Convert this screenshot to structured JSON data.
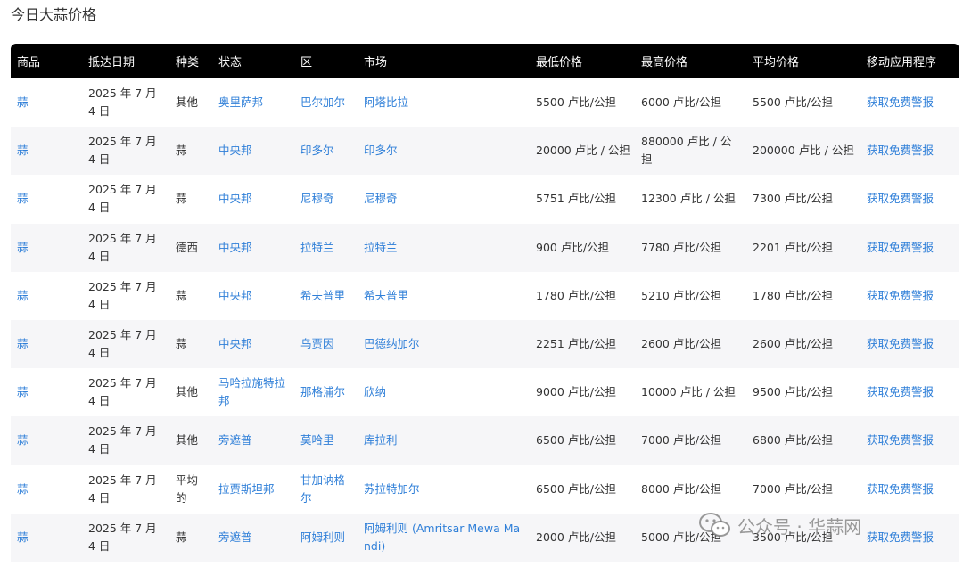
{
  "page_title": "今日大蒜价格",
  "columns": [
    "商品",
    "抵达日期",
    "种类",
    "状态",
    "区",
    "市场",
    "最低价格",
    "最高价格",
    "平均价格",
    "移动应用程序"
  ],
  "rows": [
    {
      "commodity": "蒜",
      "date": "2025 年 7 月 4 日",
      "variety": "其他",
      "state": "奥里萨邦",
      "district": "巴尔加尔",
      "market": "阿塔比拉",
      "min": "5500 卢比/公担",
      "max": "6000 卢比/公担",
      "avg": "5500 卢比/公担",
      "app": "获取免费警报"
    },
    {
      "commodity": "蒜",
      "date": "2025 年 7 月 4 日",
      "variety": "蒜",
      "state": "中央邦",
      "district": "印多尔",
      "market": "印多尔",
      "min": "20000 卢比 / 公担",
      "max": "880000 卢比 / 公担",
      "avg": "200000 卢比 / 公担",
      "app": "获取免费警报"
    },
    {
      "commodity": "蒜",
      "date": "2025 年 7 月 4 日",
      "variety": "蒜",
      "state": "中央邦",
      "district": "尼穆奇",
      "market": "尼穆奇",
      "min": "5751 卢比/公担",
      "max": "12300 卢比 / 公担",
      "avg": "7300 卢比/公担",
      "app": "获取免费警报"
    },
    {
      "commodity": "蒜",
      "date": "2025 年 7 月 4 日",
      "variety": "德西",
      "state": "中央邦",
      "district": "拉特兰",
      "market": "拉特兰",
      "min": "900 卢比/公担",
      "max": "7780 卢比/公担",
      "avg": "2201 卢比/公担",
      "app": "获取免费警报"
    },
    {
      "commodity": "蒜",
      "date": "2025 年 7 月 4 日",
      "variety": "蒜",
      "state": "中央邦",
      "district": "希夫普里",
      "market": "希夫普里",
      "min": "1780 卢比/公担",
      "max": "5210 卢比/公担",
      "avg": "1780 卢比/公担",
      "app": "获取免费警报"
    },
    {
      "commodity": "蒜",
      "date": "2025 年 7 月 4 日",
      "variety": "蒜",
      "state": "中央邦",
      "district": "乌贾因",
      "market": "巴德纳加尔",
      "min": "2251 卢比/公担",
      "max": "2600 卢比/公担",
      "avg": "2600 卢比/公担",
      "app": "获取免费警报"
    },
    {
      "commodity": "蒜",
      "date": "2025 年 7 月 4 日",
      "variety": "其他",
      "state": "马哈拉施特拉邦",
      "district": "那格浦尔",
      "market": "欣纳",
      "min": "9000 卢比/公担",
      "max": "10000 卢比 / 公担",
      "avg": "9500 卢比/公担",
      "app": "获取免费警报"
    },
    {
      "commodity": "蒜",
      "date": "2025 年 7 月 4 日",
      "variety": "其他",
      "state": "旁遮普",
      "district": "莫哈里",
      "market": "库拉利",
      "min": "6500 卢比/公担",
      "max": "7000 卢比/公担",
      "avg": "6800 卢比/公担",
      "app": "获取免费警报"
    },
    {
      "commodity": "蒜",
      "date": "2025 年 7 月 4 日",
      "variety": "平均的",
      "state": "拉贾斯坦邦",
      "district": "甘加讷格尔",
      "market": "苏拉特加尔",
      "min": "6500 卢比/公担",
      "max": "8000 卢比/公担",
      "avg": "7000 卢比/公担",
      "app": "获取免费警报"
    },
    {
      "commodity": "蒜",
      "date": "2025 年 7 月 4 日",
      "variety": "蒜",
      "state": "旁遮普",
      "district": "阿姆利则",
      "market": "阿姆利则 (Amritsar Mewa Mandi)",
      "min": "2000 卢比/公担",
      "max": "5000 卢比/公担",
      "avg": "3500 卢比/公担",
      "app": "获取免费警报"
    }
  ],
  "watermark": {
    "text": "公众号 · 华蒜网",
    "icon": "wechat-icon"
  }
}
